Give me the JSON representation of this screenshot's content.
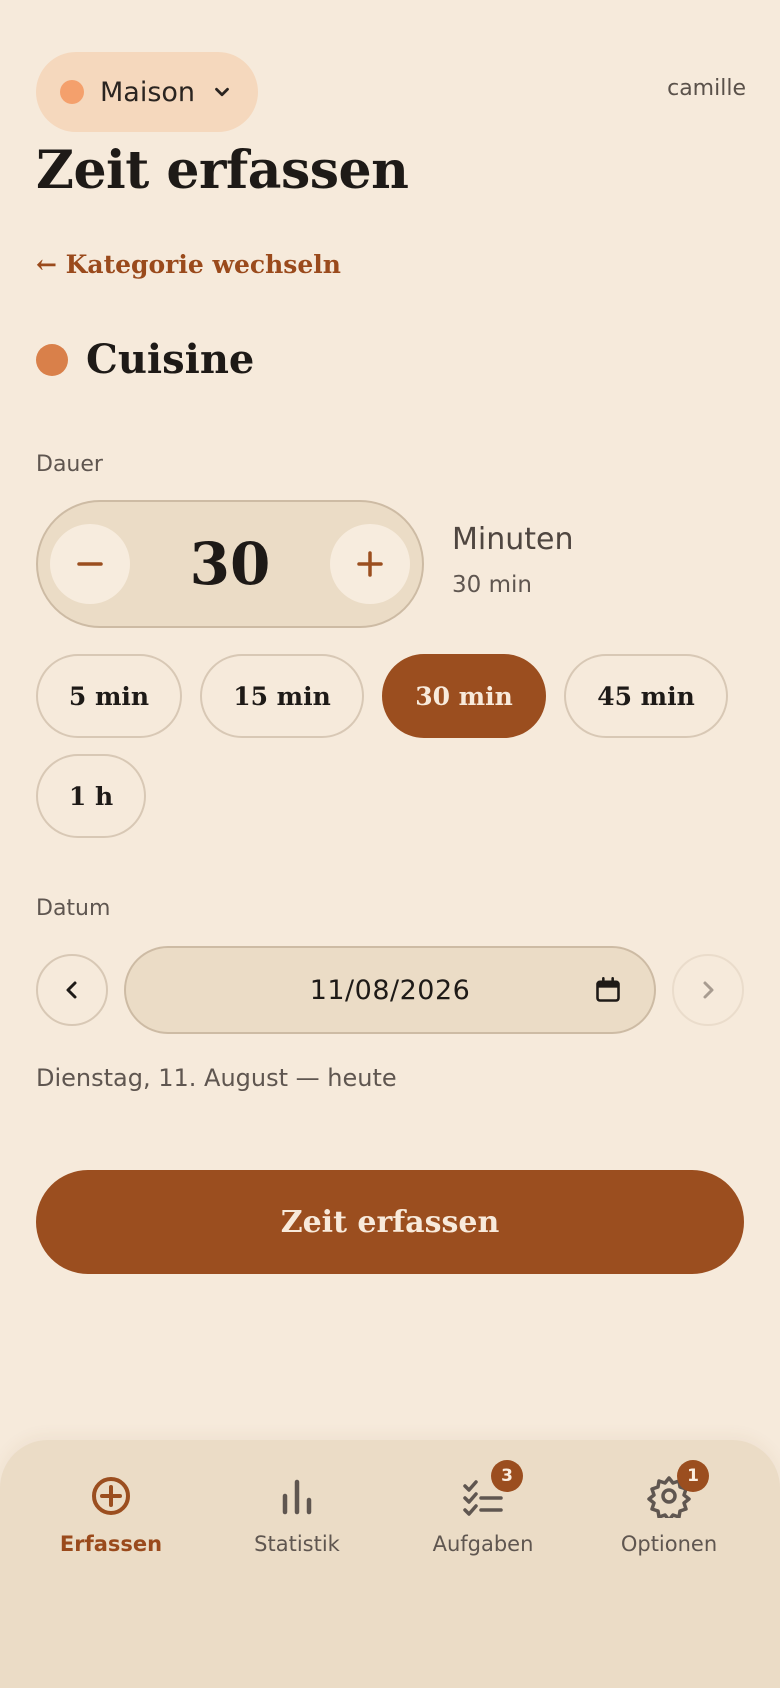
{
  "header": {
    "household": {
      "label": "Maison",
      "dot_color": "#f4a06c",
      "chevron_icon": "chevron-down-icon"
    },
    "user": "camille",
    "title": "Zeit erfassen",
    "back_link": "← Kategorie wechseln"
  },
  "category": {
    "name": "Cuisine",
    "color": "#d9804a"
  },
  "duration": {
    "label": "Dauer",
    "value": "30",
    "unit": "Minuten",
    "summary": "30 min",
    "decrement_icon": "minus-icon",
    "increment_icon": "plus-icon",
    "presets": [
      {
        "label": "5 min",
        "active": false
      },
      {
        "label": "15 min",
        "active": false
      },
      {
        "label": "30 min",
        "active": true
      },
      {
        "label": "45 min",
        "active": false
      },
      {
        "label": "1 h",
        "active": false
      }
    ]
  },
  "date": {
    "label": "Datum",
    "value": "11/08/2026",
    "caption": "Dienstag, 11. August — heute",
    "prev_icon": "chevron-left-icon",
    "next_icon": "chevron-right-icon",
    "calendar_icon": "calendar-icon"
  },
  "submit_label": "Zeit erfassen",
  "nav": [
    {
      "label": "Erfassen",
      "icon": "plus-circle-icon",
      "active": true,
      "badge": ""
    },
    {
      "label": "Statistik",
      "icon": "bar-chart-icon",
      "active": false,
      "badge": ""
    },
    {
      "label": "Aufgaben",
      "icon": "checklist-icon",
      "active": false,
      "badge": "3"
    },
    {
      "label": "Optionen",
      "icon": "gear-icon",
      "active": false,
      "badge": "1"
    }
  ],
  "colors": {
    "background": "#f6eadb",
    "accent": "#9b4e1f",
    "surface": "#ebdcc6"
  }
}
